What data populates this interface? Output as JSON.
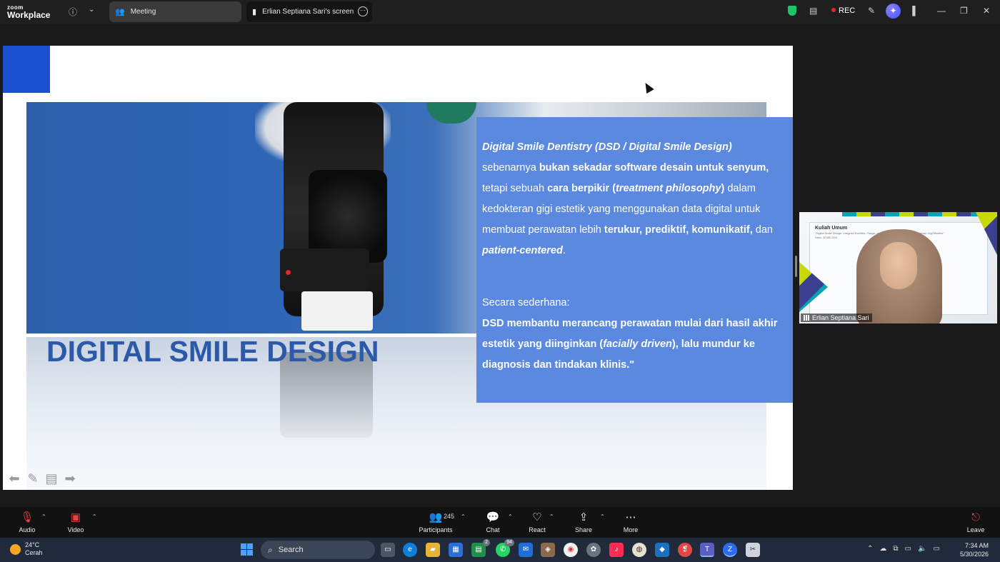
{
  "titlebar": {
    "logo_line1": "zoom",
    "logo_line2": "Workplace",
    "tab_meeting": "Meeting",
    "tab_screen": "Erlian Septiana Sari's screen",
    "rec_label": "REC",
    "tab_more_glyph": "···"
  },
  "slide": {
    "heading": "DIGITAL SMILE DESIGN",
    "para1_title": "Digital Smile Dentistry (DSD / Digital Smile Design)",
    "para1_a": " sebenarnya ",
    "para1_b": "bukan sekadar software desain untuk senyum,",
    "para1_c": " tetapi sebuah ",
    "para1_d": "cara berpikir (",
    "para1_e": "treatment philosophy",
    "para1_f": ")",
    "para1_g": " dalam kedokteran gigi estetik yang menggunakan data digital untuk membuat perawatan lebih ",
    "para1_h": "terukur, prediktif, komunikatif,",
    "para1_i": " dan ",
    "para1_j": "patient-centered",
    "para1_k": ".",
    "para2_label": "Secara sederhana:",
    "para2_a": "DSD membantu merancang perawatan mulai dari hasil akhir estetik yang diinginkan (",
    "para2_b": "facially driven",
    "para2_c": "), lalu mundur ke diagnosis dan tindakan klinis.\""
  },
  "video_tile": {
    "name": "Erlian Septiana Sari",
    "banner_title": "Kuliah Umum",
    "banner_sub": "\"Digital Smile Design: Integrasi Estetika, Fungsi, dan Teknologi Digital dalam kedokteran Gigi Modern\"",
    "banner_date": "Sabtu, 30 MEI 2026"
  },
  "toolbar": {
    "audio": "Audio",
    "video": "Video",
    "participants": "Participants",
    "participants_count": "245",
    "chat": "Chat",
    "react": "React",
    "share": "Share",
    "more": "More",
    "leave": "Leave"
  },
  "taskbar": {
    "temp": "24°C",
    "weather": "Cerah",
    "search": "Search",
    "whatsapp_badge": "94",
    "calendar_badge": "2",
    "time": "7:34 AM",
    "date": "5/30/2026"
  },
  "colors": {
    "textbox_bg": "#5b89e0",
    "heading_blue": "#2c5aa8",
    "accent_square": "#1a4fd0",
    "rec_red": "#e02828"
  }
}
